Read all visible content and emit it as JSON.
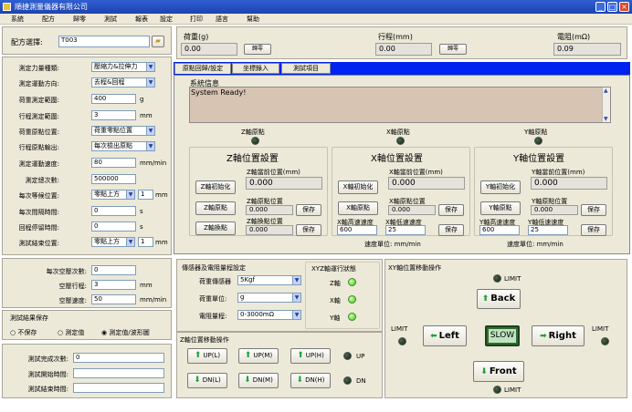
{
  "window": {
    "title": "順捷測量儀器有限公司"
  },
  "menu": [
    "系統",
    "配方",
    "歸零",
    "測試",
    "報表",
    "設定",
    "打印",
    "語言",
    "幫助"
  ],
  "left": {
    "recipe_label": "配方選擇:",
    "recipe_value": "T003",
    "rows": [
      {
        "label": "測定力量種類:",
        "value": "壓縮力&拉伸力",
        "unit": ""
      },
      {
        "label": "測定運動方向:",
        "value": "去程&回程",
        "unit": ""
      },
      {
        "label": "荷重測定範圍:",
        "value": "400",
        "unit": "g"
      },
      {
        "label": "行程測定範圍:",
        "value": "3",
        "unit": "mm"
      },
      {
        "label": "荷重原點位置:",
        "value": "荷重零點位置",
        "unit": ""
      },
      {
        "label": "行程原點輸出:",
        "value": "每次檢出原點",
        "unit": ""
      },
      {
        "label": "測定運動速度:",
        "value": "80",
        "unit": "mm/min"
      },
      {
        "label": "測定總次數:",
        "value": "500000",
        "unit": ""
      },
      {
        "label": "每次等候位置:",
        "value": "零點上方",
        "value2": "1",
        "unit": "mm"
      },
      {
        "label": "每次間隔時間:",
        "value": "0",
        "unit": "s"
      },
      {
        "label": "回程停留時間:",
        "value": "0",
        "unit": "s"
      },
      {
        "label": "測試結束位置:",
        "value": "零點上方",
        "value2": "1",
        "unit": "mm"
      }
    ],
    "air": [
      {
        "label": "每次空壓次數:",
        "value": "0",
        "unit": ""
      },
      {
        "label": "空壓行程:",
        "value": "3",
        "unit": "mm"
      },
      {
        "label": "空壓速度:",
        "value": "50",
        "unit": "mm/min"
      }
    ],
    "save_title": "測試結果保存",
    "save_options": [
      "不保存",
      "測定值",
      "測定值/波形圖"
    ],
    "save_selected": 2,
    "stats": [
      {
        "label": "測試完成次數:",
        "value": "0"
      },
      {
        "label": "測試開始時間:",
        "value": ""
      },
      {
        "label": "測試結束時間:",
        "value": ""
      }
    ]
  },
  "top": {
    "load_label": "荷重(g)",
    "load_value": "0.00",
    "load_btn": "歸零",
    "stroke_label": "行程(mm)",
    "stroke_value": "0.00",
    "stroke_btn": "歸零",
    "resist_label": "電阻(mΩ)",
    "resist_value": "0.09"
  },
  "tabs": [
    "原點回歸/設定",
    "坐標錄入",
    "測試項目"
  ],
  "active_tab": 0,
  "sysinfo": {
    "title": "系統信息",
    "text": "System Ready!"
  },
  "origins": [
    {
      "label": "Z軸原點"
    },
    {
      "label": "X軸原點"
    },
    {
      "label": "Y軸原點"
    }
  ],
  "axes": [
    {
      "title": "Z軸位置設置",
      "init_btn": "Z軸初始化",
      "origin_btn": "Z軸原點",
      "goto_btn": "Z軸換點",
      "cur_label": "Z軸當前位置(mm)",
      "cur_value": "0.000",
      "a_label": "Z軸原點位置",
      "a_value": "0.000",
      "a_save": "保存",
      "b_label": "Z軸換點位置",
      "b_value": "0.000",
      "b_save": "保存"
    },
    {
      "title": "X軸位置設置",
      "init_btn": "X軸初始化",
      "origin_btn": "X軸原點",
      "cur_label": "X軸當前位置(mm)",
      "cur_value": "0.000",
      "a_label": "X軸原點位置",
      "a_value": "0.000",
      "a_save": "保存",
      "hi_label": "X軸高速速度",
      "hi_value": "600",
      "lo_label": "X軸低速速度",
      "lo_value": "25",
      "b_save": "保存",
      "speed_unit": "速度單位: mm/min"
    },
    {
      "title": "Y軸位置設置",
      "init_btn": "Y軸初始化",
      "origin_btn": "Y軸原點",
      "cur_label": "Y軸當前位置(mm)",
      "cur_value": "0.000",
      "a_label": "Y軸原點位置",
      "a_value": "0.000",
      "a_save": "保存",
      "hi_label": "Y軸高速速度",
      "hi_value": "600",
      "lo_label": "Y軸低速速度",
      "lo_value": "25",
      "b_save": "保存",
      "speed_unit": "速度單位: mm/min"
    }
  ],
  "sensor": {
    "title": "傳感器及電阻量程設定",
    "rows": [
      {
        "label": "荷重傳感器",
        "value": "5Kgf"
      },
      {
        "label": "荷重單位:",
        "value": "g"
      },
      {
        "label": "電阻量程:",
        "value": "0-3000mΩ"
      }
    ]
  },
  "xyz": {
    "title": "XYZ軸運行狀態",
    "items": [
      "Z軸",
      "X軸",
      "Y軸"
    ]
  },
  "zmove": {
    "title": "Z軸位置移動操作",
    "up": [
      "UP(L)",
      "UP(M)",
      "UP(H)"
    ],
    "up_label": "UP",
    "dn": [
      "DN(L)",
      "DN(M)",
      "DN(H)"
    ],
    "dn_label": "DN"
  },
  "xymove": {
    "title": "XY軸位置移動操作",
    "back": "Back",
    "front": "Front",
    "left": "Left",
    "right": "Right",
    "slow": "SLOW",
    "limit": "LIMIT"
  }
}
